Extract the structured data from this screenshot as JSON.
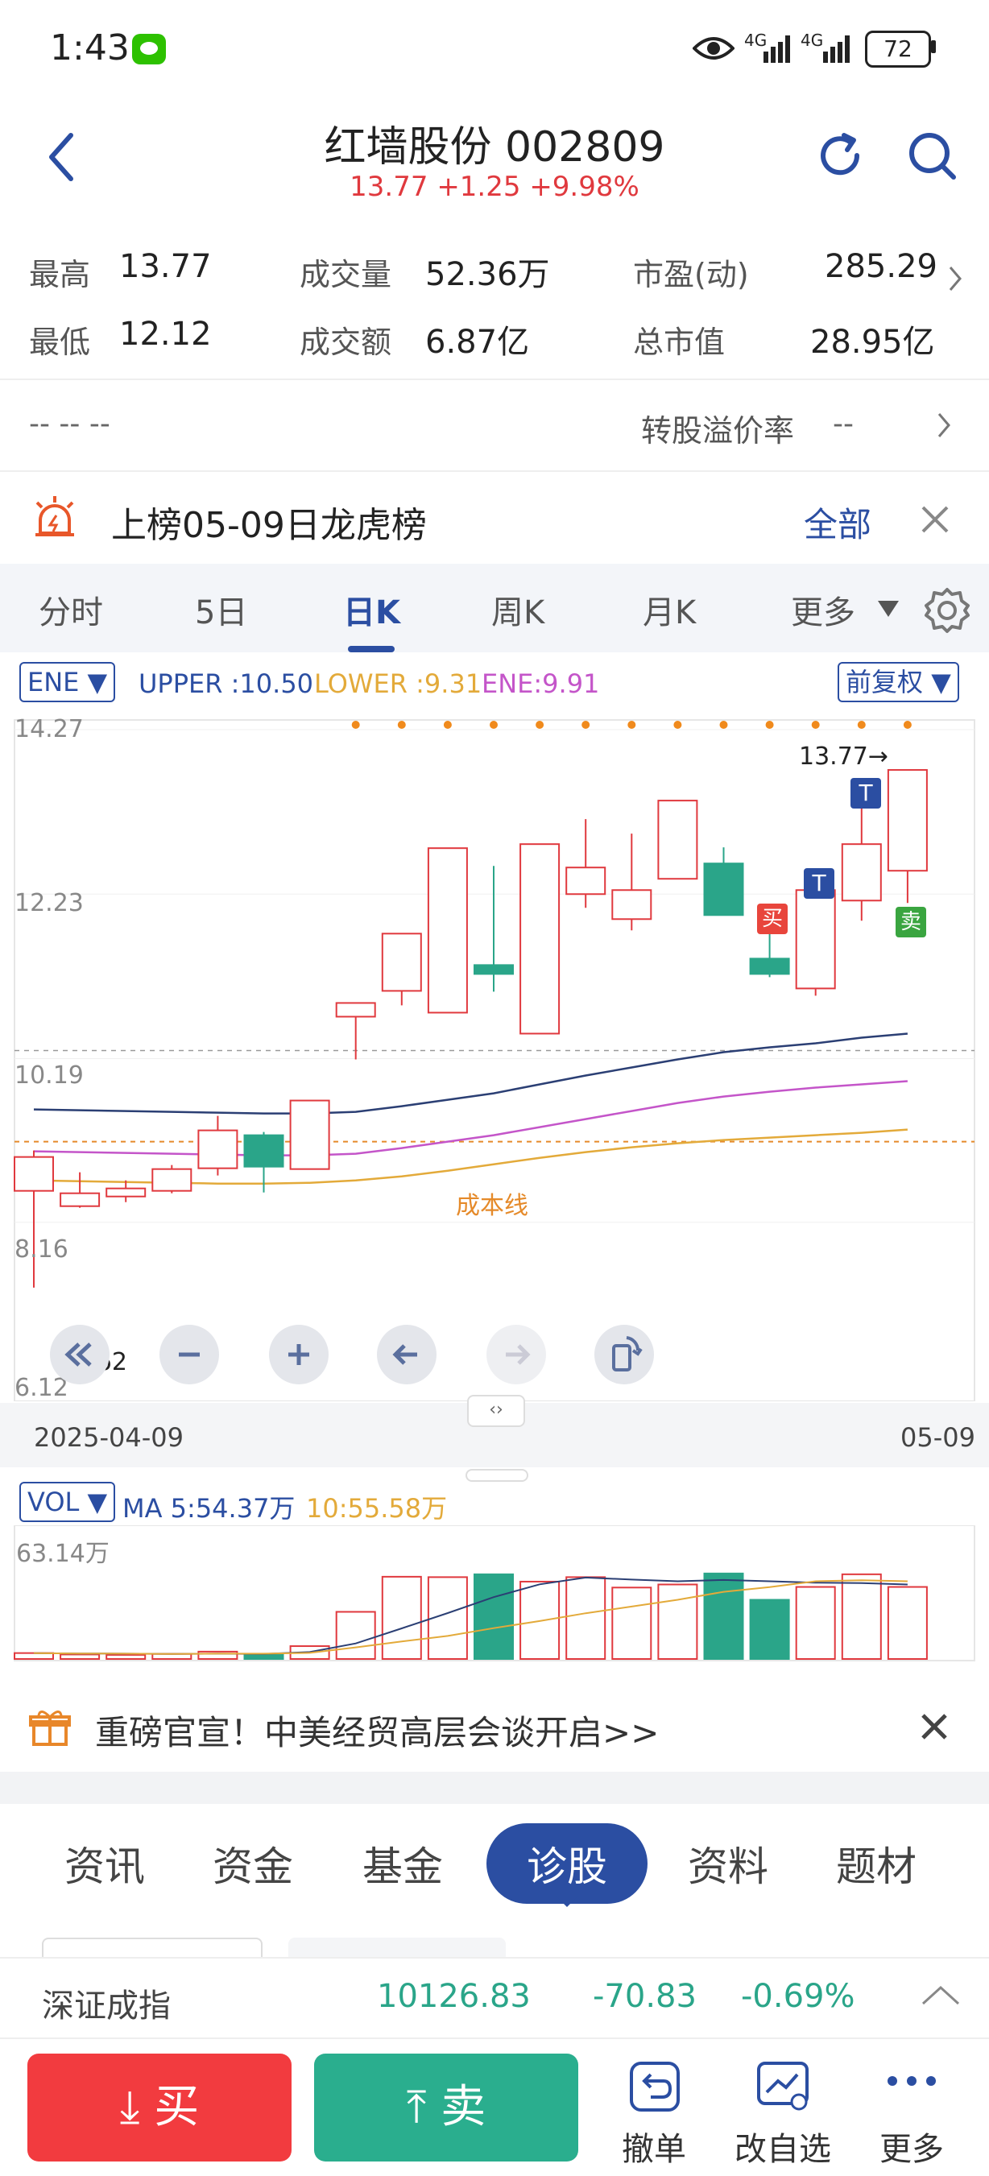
{
  "status": {
    "time": "1:43",
    "battery": "72",
    "signal1": "4G",
    "signal2": "4G"
  },
  "header": {
    "title": "红墙股份 002809",
    "subtitle": "13.77 +1.25 +9.98%"
  },
  "stats": {
    "high_label": "最高",
    "high_value": "13.77",
    "low_label": "最低",
    "low_value": "12.12",
    "volume_label": "成交量",
    "volume_value": "52.36万",
    "amount_label": "成交额",
    "amount_value": "6.87亿",
    "pe_label": "市盈(动)",
    "pe_value": "285.29",
    "mcap_label": "总市值",
    "mcap_value": "28.95亿"
  },
  "conv": {
    "left": "-- -- --",
    "label": "转股溢价率",
    "value": "--"
  },
  "dragon": {
    "text": "上榜05-09日龙虎榜",
    "all_label": "全部"
  },
  "tabs": [
    "分时",
    "5日",
    "日K",
    "周K",
    "月K",
    "更多"
  ],
  "indicator": {
    "name": "ENE",
    "upper": "UPPER :10.50",
    "lower": "LOWER :9.31",
    "ene": "ENE:9.91",
    "adjust": "前复权"
  },
  "chart_labels": {
    "y_ticks": [
      "14.27",
      "12.23",
      "10.19",
      "8.16",
      "6.12"
    ],
    "max_label": "13.77→",
    "min_label": "←6.62",
    "cost_line": "成本线",
    "date_start": "2025-04-09",
    "date_end": "05-09",
    "buy_marker": "买",
    "sell_marker": "卖",
    "t_marker": "T",
    "pan_handle": "‹›"
  },
  "volume": {
    "name": "VOL",
    "ma5": "MA 5:54.37万",
    "ma10": "10:55.58万",
    "max": "63.14万"
  },
  "ad": {
    "text": "重磅官宣！中美经贸高层会谈开启>>"
  },
  "section_tabs": [
    "资讯",
    "资金",
    "基金",
    "诊股",
    "资料",
    "题材"
  ],
  "index_bar": {
    "name": "深证成指",
    "value": "10126.83",
    "change": "-70.83",
    "pct": "-0.69%"
  },
  "bottom": {
    "buy": "买",
    "sell": "卖",
    "cancel": "撤单",
    "edit": "改自选",
    "more": "更多"
  },
  "colors": {
    "up": "#e0393e",
    "down": "#2aa589",
    "accent": "#2b4ea2",
    "upper_line": "#2b3f74",
    "ene_line": "#c455c9",
    "lower_line": "#e3aa3a",
    "cost_line": "#e58a2a"
  },
  "chart_data": {
    "type": "candlestick",
    "period": "daily",
    "ylim": [
      6.12,
      14.27
    ],
    "candles": [
      {
        "o": 8.55,
        "c": 8.97,
        "h": 9.05,
        "l": 7.35
      },
      {
        "o": 8.36,
        "c": 8.52,
        "h": 8.78,
        "l": 8.34
      },
      {
        "o": 8.48,
        "c": 8.58,
        "h": 8.68,
        "l": 8.41
      },
      {
        "o": 8.55,
        "c": 8.82,
        "h": 8.87,
        "l": 8.52
      },
      {
        "o": 8.83,
        "c": 9.3,
        "h": 9.48,
        "l": 8.74
      },
      {
        "o": 9.24,
        "c": 8.85,
        "h": 9.28,
        "l": 8.53
      },
      {
        "o": 8.82,
        "c": 9.67,
        "h": 9.67,
        "l": 8.82
      },
      {
        "o": 10.71,
        "c": 10.88,
        "h": 10.88,
        "l": 10.18
      },
      {
        "o": 11.03,
        "c": 11.74,
        "h": 11.74,
        "l": 10.85
      },
      {
        "o": 10.76,
        "c": 12.8,
        "h": 12.8,
        "l": 10.76
      },
      {
        "o": 11.35,
        "c": 11.24,
        "h": 12.58,
        "l": 11.02
      },
      {
        "o": 10.5,
        "c": 12.85,
        "h": 12.85,
        "l": 10.5
      },
      {
        "o": 12.23,
        "c": 12.56,
        "h": 13.16,
        "l": 12.06
      },
      {
        "o": 11.92,
        "c": 12.28,
        "h": 12.98,
        "l": 11.78
      },
      {
        "o": 12.42,
        "c": 13.39,
        "h": 13.39,
        "l": 12.42
      },
      {
        "o": 12.61,
        "c": 11.97,
        "h": 12.81,
        "l": 11.97
      },
      {
        "o": 11.43,
        "c": 11.24,
        "h": 12.05,
        "l": 11.2
      },
      {
        "o": 11.06,
        "c": 12.28,
        "h": 12.28,
        "l": 10.97
      },
      {
        "o": 12.15,
        "c": 12.85,
        "h": 13.4,
        "l": 11.9
      },
      {
        "o": 12.52,
        "c": 13.77,
        "h": 13.77,
        "l": 12.12
      }
    ],
    "upper": [
      9.56,
      9.55,
      9.54,
      9.53,
      9.52,
      9.51,
      9.51,
      9.53,
      9.6,
      9.68,
      9.76,
      9.87,
      9.98,
      10.08,
      10.18,
      10.27,
      10.33,
      10.38,
      10.45,
      10.5
    ],
    "ene": [
      9.04,
      9.03,
      9.02,
      9.01,
      9.0,
      8.99,
      8.99,
      9.01,
      9.08,
      9.16,
      9.24,
      9.34,
      9.44,
      9.54,
      9.64,
      9.72,
      9.78,
      9.83,
      9.87,
      9.91
    ],
    "lower": [
      8.68,
      8.67,
      8.66,
      8.65,
      8.64,
      8.64,
      8.65,
      8.68,
      8.73,
      8.8,
      8.88,
      8.96,
      9.03,
      9.09,
      9.14,
      9.18,
      9.21,
      9.24,
      9.27,
      9.31
    ],
    "volumes": [
      2.9,
      2.2,
      2.0,
      2.5,
      3.6,
      2.5,
      6.3,
      23.1,
      40.3,
      40.1,
      41.5,
      37.9,
      40.1,
      35.0,
      36.5,
      41.9,
      29.0,
      35.3,
      41.5,
      35.3
    ],
    "vol_ma5": [
      2.9,
      2.7,
      2.6,
      2.5,
      2.6,
      2.5,
      3.4,
      7.6,
      15.0,
      22.5,
      30.3,
      36.6,
      39.9,
      38.9,
      38.1,
      38.7,
      38.1,
      37.4,
      37.2,
      36.5
    ],
    "vol_ma10": [
      2.9,
      2.7,
      2.6,
      2.5,
      2.6,
      2.6,
      3.0,
      5.7,
      8.6,
      11.3,
      15.1,
      18.6,
      22.4,
      25.7,
      29.0,
      32.9,
      35.2,
      38.1,
      38.6,
      38.1
    ],
    "vol_max": 63.14
  }
}
